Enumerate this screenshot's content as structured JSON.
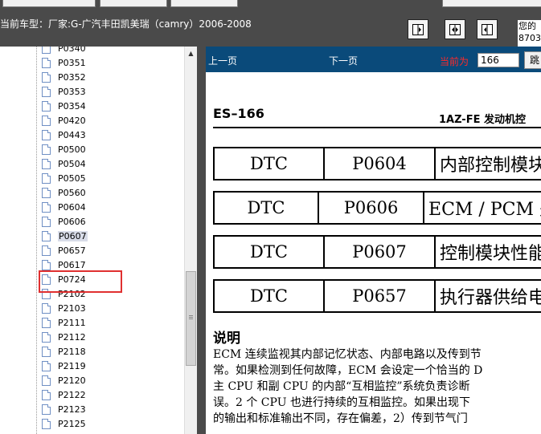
{
  "top": {
    "vehicle_label": "当前车型：厂家:G-广汽丰田凯美瑞（camry）2006-2008",
    "top_right_line1": "您的",
    "top_right_line2": "8703"
  },
  "tree": {
    "items": [
      {
        "label": "P0340"
      },
      {
        "label": "P0351"
      },
      {
        "label": "P0352"
      },
      {
        "label": "P0353"
      },
      {
        "label": "P0354"
      },
      {
        "label": "P0420"
      },
      {
        "label": "P0443"
      },
      {
        "label": "P0500"
      },
      {
        "label": "P0504"
      },
      {
        "label": "P0505"
      },
      {
        "label": "P0560"
      },
      {
        "label": "P0604"
      },
      {
        "label": "P0606"
      },
      {
        "label": "P0607"
      },
      {
        "label": "P0657"
      },
      {
        "label": "P0617"
      },
      {
        "label": "P0724"
      },
      {
        "label": "P2102"
      },
      {
        "label": "P2103"
      },
      {
        "label": "P2111"
      },
      {
        "label": "P2112"
      },
      {
        "label": "P2118"
      },
      {
        "label": "P2119"
      },
      {
        "label": "P2120"
      },
      {
        "label": "P2122"
      },
      {
        "label": "P2123"
      },
      {
        "label": "P2125"
      }
    ],
    "selected": "P0607"
  },
  "nav": {
    "prev_label": "上一页",
    "next_label": "下一页",
    "current_label": "当前为",
    "page_value": "166",
    "jump_label": "跳"
  },
  "doc": {
    "page_code": "ES–166",
    "header_right": "1AZ-FE 发动机控",
    "dtc_rows": [
      {
        "dtc": "DTC",
        "code": "P0604",
        "desc": "内部控制模块"
      },
      {
        "dtc": "DTC",
        "code": "P0606",
        "desc": "ECM / PCM 处"
      },
      {
        "dtc": "DTC",
        "code": "P0607",
        "desc": "控制模块性能"
      },
      {
        "dtc": "DTC",
        "code": "P0657",
        "desc": "执行器供给电"
      }
    ],
    "section_title": "说明",
    "body_lines": [
      "ECM 连续监视其内部记忆状态、内部电路以及传到节",
      "常。如果检测到任何故障，ECM 会设定一个恰当的 D",
      "主 CPU 和副 CPU 的内部“互相监控”系统负责诊断",
      "误。2 个 CPU 也进行持续的互相监控。如果出现下",
      "的输出和标准输出不同，存在偏差，2）传到节气门"
    ]
  },
  "colors": {
    "nav_bar": "#0a4a7a",
    "highlight": "#e03030",
    "current_label": "#ff2a2a"
  }
}
